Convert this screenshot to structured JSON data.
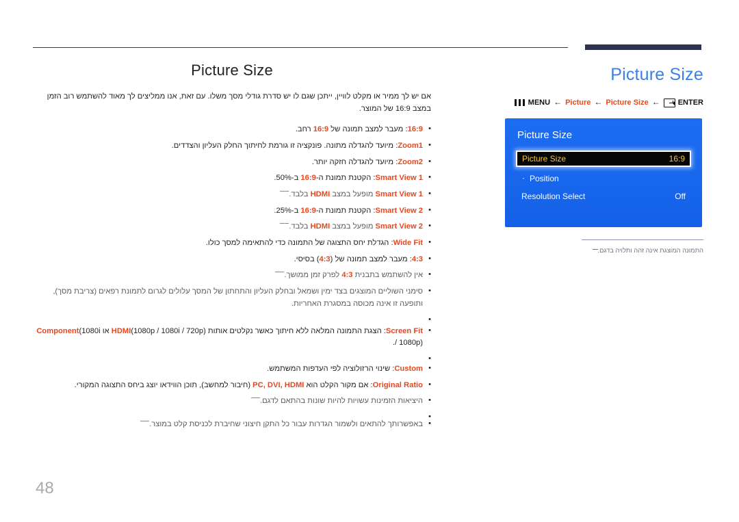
{
  "page": {
    "title": "Picture Size",
    "number": "48"
  },
  "left": {
    "title": "Picture Size",
    "intro": "אם יש לך ממיר או מקלט לוויין, ייתכן שגם לו יש סדרת גודלי מסך משלו. עם זאת, אנו ממליצים לך מאוד להשתמש רוב הזמן במצב 16:9 של המוצר.",
    "options": [
      {
        "key": "16:9",
        "text": ": מעבר למצב תמונה של ",
        "key2": "16:9",
        "text2": " רחב."
      },
      {
        "key": "Zoom1",
        "text": ": מיועד להגדלה מתונה. פונקציה זו גורמת לחיתוך החלק העליון והצדדים."
      },
      {
        "key": "Zoom2",
        "text": ": מיועד להגדלה חזקה יותר."
      },
      {
        "key": "Smart View 1",
        "text": ": הקטנת תמונת ה-",
        "key2": "16:9",
        "text2": " ב-50%."
      },
      {
        "key": "Smart View 2",
        "text": ": הקטנת תמונת ה-",
        "key2": "16:9",
        "text2": " ב-25%."
      },
      {
        "key": "Wide Fit",
        "text": ": הגדלת יחס התצוגה של התמונה כדי להתאימה למסך כולו."
      },
      {
        "key": "4:3",
        "text": ": מעבר למצב תמונה של (",
        "key2": "4:3",
        "text2": ") בסיסי."
      },
      {
        "key": "Screen Fit",
        "text": ": הצגת התמונה המלאה ללא חיתוך כאשר נקלטים אותות "
      },
      {
        "key": "Custom",
        "text": ": שינוי הרזולוציה לפי העדפות המשתמש."
      },
      {
        "key": "Original Ratio",
        "text": ": אם מקור הקלט הוא "
      }
    ],
    "notes": {
      "smart_view_1": {
        "key": "Smart View 1",
        "mid": " מופעל במצב ",
        "key2": "HDMI",
        "tail": " בלבד."
      },
      "smart_view_2": {
        "key": "Smart View 2",
        "mid": " מופעל במצב ",
        "key2": "HDMI",
        "tail": " בלבד."
      },
      "four_three": {
        "head": "אין להשתמש בתבנית ",
        "key": "4:3",
        "tail": " לפרק זמן ממושך."
      },
      "burn_in": "סימני השוליים המוצגים בצד ימין ושמאל ובחלק העליון והתחתון של המסך עלולים לגרום לתמונת רפאים (צריבת מסך), ותופעה זו אינה מכוסה במסגרת האחריות.",
      "outputs": "היציאות הזמינות עשויות להיות שונות בהתאם לדגם.",
      "save_settings": "באפשרותך להתאים ולשמור הגדרות עבור כל התקן חיצוני שחיברת לכניסת קלט במוצר."
    },
    "screen_fit_signals": {
      "key": "HDMI",
      "signals": "(1080p / 1080i / 720p)",
      "or": " או ",
      "key2": "Component",
      "signals2": "(1080i / 1080p)."
    },
    "original_ratio_sources": {
      "key": "PC, DVI, HDMI",
      "mid": " (חיבור למחשב), תוכן הווידאו יוצג ביחס התצוגה המקורי."
    }
  },
  "right": {
    "title": "Picture Size",
    "breadcrumb": {
      "menu_icon": "menu-icon",
      "menu_label": "MENU",
      "arrow": "←",
      "item1": "Picture",
      "item2": "Picture Size",
      "enter_icon": "enter-icon",
      "enter_label": "ENTER"
    },
    "osd": {
      "title": "Picture Size",
      "rows": [
        {
          "label": "Picture Size",
          "value": "16:9",
          "selected": true
        },
        {
          "label": "Position",
          "value": "",
          "sub": true
        },
        {
          "label": "Resolution Select",
          "value": "Off"
        }
      ]
    },
    "note": "התמונה המוצגת אינה זהה ותלויה בדגם."
  },
  "colors": {
    "accent_red": "#e8471e",
    "title_blue": "#3b7fe8",
    "osd_blue": "#1768f0",
    "osd_highlight_text": "#f5c842",
    "rule_navy": "#2e3050"
  }
}
